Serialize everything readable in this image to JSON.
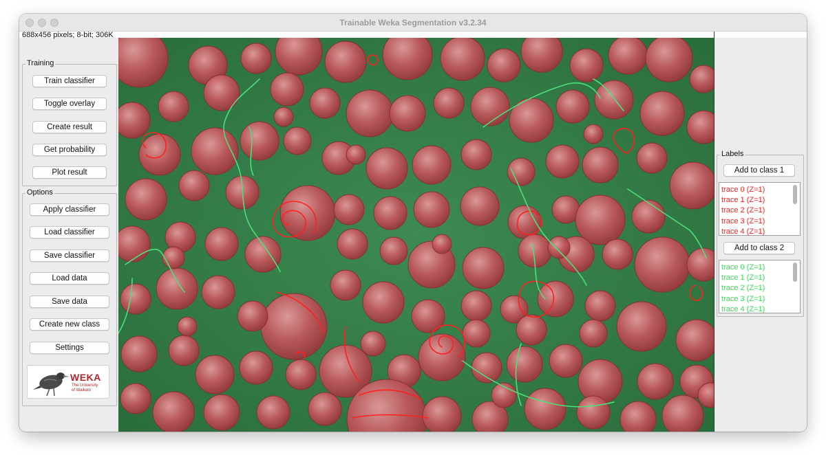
{
  "window": {
    "title": "Trainable Weka Segmentation v3.2.34"
  },
  "image_info": "688x456 pixels; 8-bit; 306K",
  "training": {
    "title": "Training",
    "buttons": [
      "Train classifier",
      "Toggle overlay",
      "Create result",
      "Get probability",
      "Plot result"
    ]
  },
  "options": {
    "title": "Options",
    "buttons": [
      "Apply classifier",
      "Load classifier",
      "Save classifier",
      "Load data",
      "Save data",
      "Create new class",
      "Settings"
    ]
  },
  "logo": {
    "name": "WEKA",
    "subtitle": [
      "The University",
      "of Waikato"
    ]
  },
  "labels": {
    "title": "Labels",
    "class1": {
      "button": "Add to class 1",
      "color": "#ff1a1a",
      "traces": [
        "trace 0 (Z=1)",
        "trace 1 (Z=1)",
        "trace 2 (Z=1)",
        "trace 3 (Z=1)",
        "trace 4 (Z=1)"
      ]
    },
    "class2": {
      "button": "Add to class 2",
      "color": "#33dd55",
      "traces": [
        "trace 0 (Z=1)",
        "trace 1 (Z=1)",
        "trace 2 (Z=1)",
        "trace 3 (Z=1)",
        "trace 4 (Z=1)"
      ]
    }
  },
  "colors": {
    "overlay_class1": "#b5474c",
    "overlay_class2": "#2f7a44"
  }
}
